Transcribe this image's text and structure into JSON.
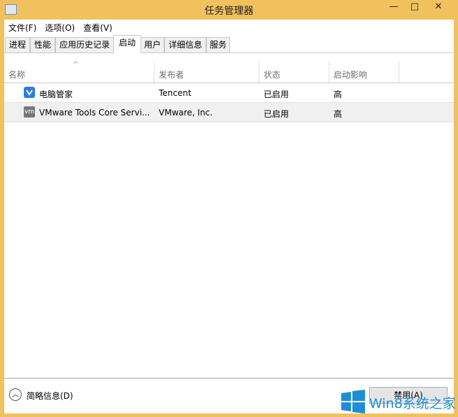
{
  "window": {
    "title": "任务管理器",
    "minimize": "—",
    "maximize": "□",
    "close": "✕"
  },
  "menu": [
    "文件(F)",
    "选项(O)",
    "查看(V)"
  ],
  "tabs": [
    "进程",
    "性能",
    "应用历史记录",
    "启动",
    "用户",
    "详细信息",
    "服务"
  ],
  "active_tab": "启动",
  "columns": [
    "名称",
    "发布者",
    "状态",
    "启动影响"
  ],
  "sort_indicator": "^",
  "rows": [
    {
      "name": "电脑管家",
      "publisher": "Tencent",
      "status": "已启用",
      "impact": "高",
      "icon": "tencent-shield-icon"
    },
    {
      "name": "VMware Tools Core Servi...",
      "publisher": "VMware, Inc.",
      "status": "已启用",
      "impact": "高",
      "icon": "vmware-icon"
    }
  ],
  "footer": {
    "less_details": "简略信息(D)",
    "disable_button": "禁用(A)"
  },
  "watermark": {
    "text": "Win8系统之家",
    "color": "#1e8fd6"
  }
}
